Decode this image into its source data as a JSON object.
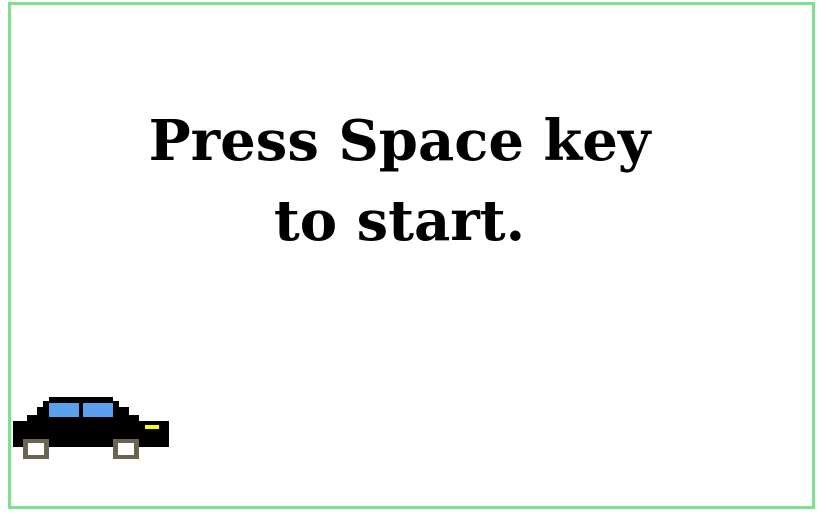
{
  "game": {
    "message_line1": "Press Space key",
    "message_line2": "to start.",
    "border_color": "#7ee08e"
  },
  "car": {
    "body_color": "#000000",
    "window_color": "#5aa0ec",
    "headlight_color": "#ffff00",
    "wheel_rim_color": "#6b6452",
    "wheel_hub_color": "#ffffff"
  }
}
